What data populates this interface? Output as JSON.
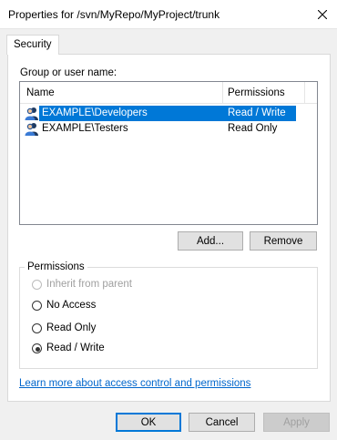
{
  "window": {
    "title": "Properties for /svn/MyRepo/MyProject/trunk",
    "close_icon": "close-icon"
  },
  "tabs": [
    {
      "label": "Security",
      "active": true
    }
  ],
  "security": {
    "group_label": "Group or user name:",
    "columns": {
      "name": "Name",
      "permissions": "Permissions"
    },
    "entries": [
      {
        "name": "EXAMPLE\\Developers",
        "permissions": "Read / Write",
        "selected": true,
        "icon": "user-group-icon"
      },
      {
        "name": "EXAMPLE\\Testers",
        "permissions": "Read Only",
        "selected": false,
        "icon": "user-group-icon"
      }
    ],
    "add_label": "Add...",
    "remove_label": "Remove",
    "permissions_group": {
      "legend": "Permissions",
      "options": [
        {
          "label": "Inherit from parent",
          "checked": false,
          "enabled": false
        },
        {
          "label": "No Access",
          "checked": false,
          "enabled": true
        },
        {
          "label": "Read Only",
          "checked": false,
          "enabled": true
        },
        {
          "label": "Read / Write",
          "checked": true,
          "enabled": true
        }
      ]
    },
    "learn_more_link": "Learn more about access control and permissions"
  },
  "footer": {
    "ok_label": "OK",
    "cancel_label": "Cancel",
    "apply_label": "Apply",
    "apply_enabled": false
  },
  "colors": {
    "selection": "#0078d7",
    "link": "#0066cc",
    "dialog_bg": "#f0f0f0"
  }
}
